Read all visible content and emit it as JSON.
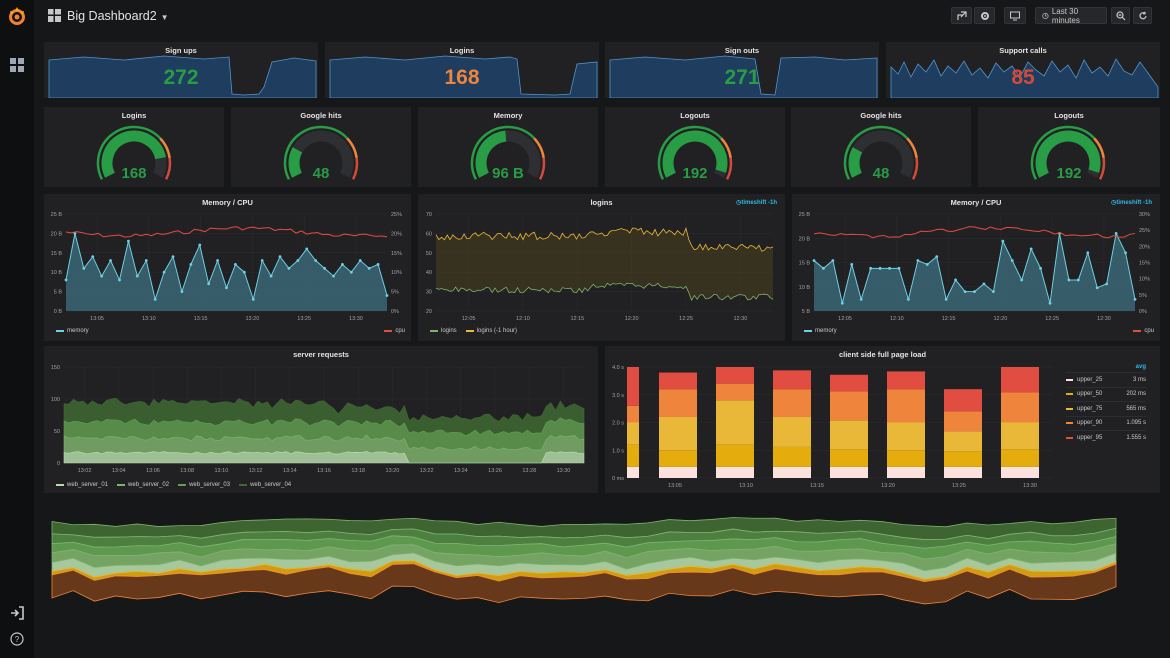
{
  "nav": {
    "title": "Big Dashboard2",
    "time_range": "Last 30 minutes",
    "buttons": [
      "share-icon",
      "settings-icon",
      "tv-mode-icon",
      "clock-icon",
      "zoom-out-icon",
      "refresh-icon"
    ]
  },
  "sidemenu": {
    "icons": [
      "grafana-logo-icon",
      "dashboards-icon",
      "sign-in-icon",
      "help-icon"
    ]
  },
  "stats": [
    {
      "title": "Sign ups",
      "value": "272",
      "color": "#299c46"
    },
    {
      "title": "Logins",
      "value": "168",
      "color": "#ef843c"
    },
    {
      "title": "Sign outs",
      "value": "271",
      "color": "#299c46"
    },
    {
      "title": "Support calls",
      "value": "85",
      "color": "#d44a3a"
    }
  ],
  "gauges": [
    {
      "title": "Logins",
      "value": "168",
      "fill": 0.84
    },
    {
      "title": "Google hits",
      "value": "48",
      "fill": 0.24
    },
    {
      "title": "Memory",
      "value": "96 B",
      "fill": 0.48
    },
    {
      "title": "Logouts",
      "value": "192",
      "fill": 0.96
    },
    {
      "title": "Google hits",
      "value": "48",
      "fill": 0.24
    },
    {
      "title": "Logouts",
      "value": "192",
      "fill": 0.96
    }
  ],
  "memcpu1": {
    "title": "Memory / CPU",
    "y_left_ticks": [
      "25 B",
      "20 B",
      "15 B",
      "10 B",
      "5 B",
      "0 B"
    ],
    "y_right_ticks": [
      "25%",
      "20%",
      "15%",
      "10%",
      "5%",
      "0%"
    ],
    "x_ticks": [
      "13:05",
      "13:10",
      "13:15",
      "13:20",
      "13:25",
      "13:30"
    ],
    "legend_left": "memory",
    "legend_right": "cpu"
  },
  "logins_panel": {
    "title": "logins",
    "tag": "timeshift -1h",
    "y_ticks": [
      "70",
      "60",
      "50",
      "40",
      "30",
      "20"
    ],
    "x_ticks": [
      "12:05",
      "12:10",
      "12:15",
      "12:20",
      "12:25",
      "12:30"
    ],
    "legend": [
      "logins",
      "logins (-1 hour)"
    ]
  },
  "memcpu2": {
    "title": "Memory / CPU",
    "tag": "timeshift -1h",
    "y_left_ticks": [
      "25 B",
      "20 B",
      "15 B",
      "10 B",
      "5 B"
    ],
    "y_right_ticks": [
      "30%",
      "25%",
      "20%",
      "15%",
      "10%",
      "5%",
      "0%"
    ],
    "x_ticks": [
      "12:05",
      "12:10",
      "12:15",
      "12:20",
      "12:25",
      "12:30"
    ],
    "legend_left": "memory",
    "legend_right": "cpu"
  },
  "server_requests": {
    "title": "server requests",
    "y_ticks": [
      "150",
      "100",
      "50",
      "0"
    ],
    "x_ticks": [
      "13:02",
      "13:04",
      "13:06",
      "13:08",
      "13:10",
      "13:12",
      "13:14",
      "13:16",
      "13:18",
      "13:20",
      "13:22",
      "13:24",
      "13:26",
      "13:28",
      "13:30"
    ],
    "legend": [
      "web_server_01",
      "web_server_02",
      "web_server_03",
      "web_server_04"
    ]
  },
  "page_load": {
    "title": "client side full page load",
    "y_ticks": [
      "4.0 s",
      "3.0 s",
      "2.0 s",
      "1.0 s",
      "0 ms"
    ],
    "x_ticks": [
      "13:05",
      "13:10",
      "13:15",
      "13:20",
      "13:25",
      "13:30"
    ],
    "legend_header": "avg",
    "legend": [
      {
        "name": "upper_25",
        "value": "3 ms",
        "color": "#fce2de"
      },
      {
        "name": "upper_50",
        "value": "202 ms",
        "color": "#e5ac0e"
      },
      {
        "name": "upper_75",
        "value": "565 ms",
        "color": "#eab839"
      },
      {
        "name": "upper_90",
        "value": "1.095 s",
        "color": "#ef843c"
      },
      {
        "name": "upper_95",
        "value": "1.555 s",
        "color": "#e24d42"
      }
    ]
  }
}
